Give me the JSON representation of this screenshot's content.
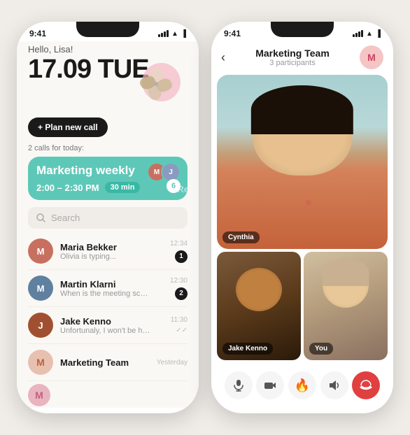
{
  "left_phone": {
    "status_time": "9:41",
    "greeting": "Hello, Lisa!",
    "date": "17.09 TUE",
    "plan_btn": "+ Plan new call",
    "calls_label": "2 calls for today:",
    "call_card": {
      "title": "Marketing weekly",
      "time": "2:00 – 2:30 PM",
      "duration": "30 min",
      "re": "Re",
      "six": "6"
    },
    "search_placeholder": "Search",
    "contacts": [
      {
        "name": "Maria Bekker",
        "preview": "Olivia is typing...",
        "time": "12:34",
        "unread": "1",
        "color": "#c87060"
      },
      {
        "name": "Martin Klarni",
        "preview": "When is the meeting schedu...",
        "time": "12:30",
        "unread": "2",
        "color": "#6080a0"
      },
      {
        "name": "Jake Kenno",
        "preview": "Unfortunaly, I won't be here t...",
        "time": "11:30",
        "unread": "",
        "color": "#a05030"
      },
      {
        "name": "Marketing Team",
        "preview": "",
        "time": "Yesterday",
        "unread": "",
        "color": "#e8c0b0",
        "initials": "M"
      }
    ]
  },
  "right_phone": {
    "status_time": "9:41",
    "title": "Marketing Team",
    "participants": "3 participants",
    "header_initial": "M",
    "videos": [
      {
        "name": "Cynthia",
        "label": "Cynthia"
      },
      {
        "name": "Jake Kenno",
        "label": "Jake Kenno"
      },
      {
        "name": "You",
        "label": "You"
      }
    ],
    "controls": [
      {
        "icon": "🎤",
        "name": "microphone"
      },
      {
        "icon": "📷",
        "name": "camera"
      },
      {
        "icon": "🔥",
        "name": "fire"
      },
      {
        "icon": "🔈",
        "name": "speaker"
      },
      {
        "icon": "📞",
        "name": "end-call",
        "end": true
      }
    ]
  }
}
